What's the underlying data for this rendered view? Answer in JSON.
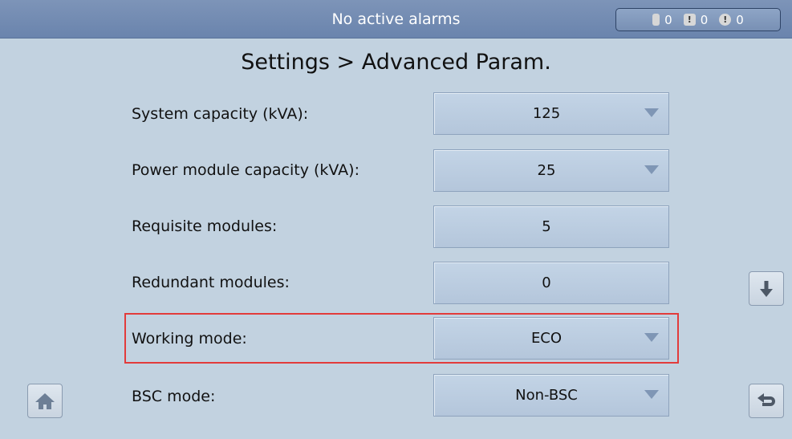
{
  "topbar": {
    "status": "No active alarms",
    "alarms": {
      "critical_count": "0",
      "major_count": "0",
      "minor_count": "0"
    }
  },
  "page": {
    "title": "Settings > Advanced Param."
  },
  "params": [
    {
      "label": "System capacity (kVA):",
      "value": "125",
      "dropdown": true
    },
    {
      "label": "Power module capacity (kVA):",
      "value": "25",
      "dropdown": true
    },
    {
      "label": "Requisite modules:",
      "value": "5",
      "dropdown": false
    },
    {
      "label": "Redundant modules:",
      "value": "0",
      "dropdown": false
    },
    {
      "label": "Working mode:",
      "value": "ECO",
      "dropdown": true
    },
    {
      "label": "BSC mode:",
      "value": "Non-BSC",
      "dropdown": true
    }
  ],
  "icons": {
    "home": "home-icon",
    "scroll_down": "arrow-down-icon",
    "back": "back-arrow-icon"
  },
  "colors": {
    "highlight": "#e23b3b",
    "topbar": "#7189b0",
    "background": "#c2d2e0"
  }
}
